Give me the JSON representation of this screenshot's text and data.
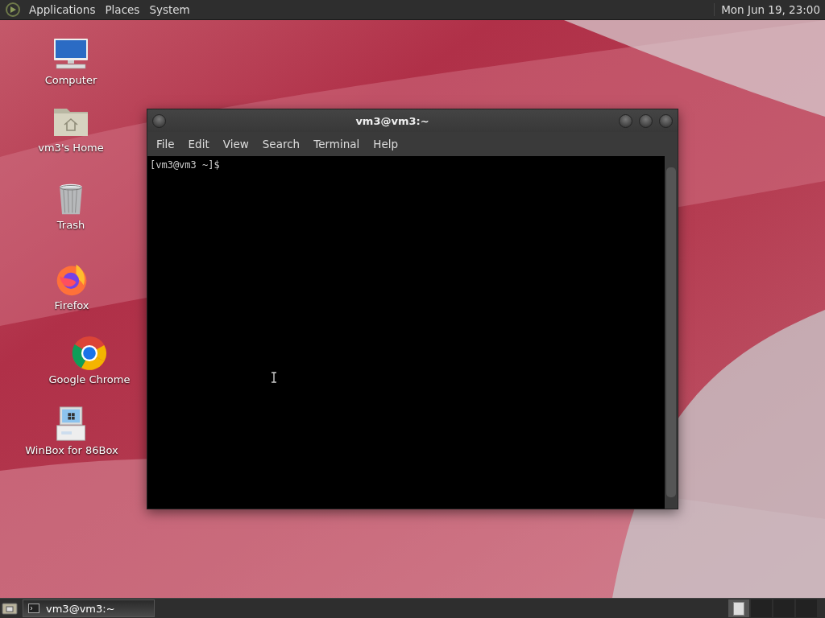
{
  "top_panel": {
    "menus": [
      "Applications",
      "Places",
      "System"
    ],
    "clock": "Mon Jun 19, 23:00"
  },
  "desktop_icons": [
    {
      "kind": "computer",
      "label": "Computer"
    },
    {
      "kind": "home",
      "label": "vm3's Home"
    },
    {
      "kind": "trash",
      "label": "Trash"
    },
    {
      "kind": "firefox",
      "label": "Firefox"
    },
    {
      "kind": "chrome",
      "label": "Google Chrome"
    },
    {
      "kind": "winbox",
      "label": "WinBox for 86Box"
    }
  ],
  "terminal": {
    "title": "vm3@vm3:~",
    "menus": [
      "File",
      "Edit",
      "View",
      "Search",
      "Terminal",
      "Help"
    ],
    "prompt": "[vm3@vm3 ~]$"
  },
  "taskbar": {
    "tasks": [
      {
        "label": "vm3@vm3:~",
        "selected": true
      }
    ],
    "workspaces": [
      {
        "selected": true
      },
      {
        "selected": false
      },
      {
        "selected": false
      },
      {
        "selected": false
      }
    ]
  }
}
